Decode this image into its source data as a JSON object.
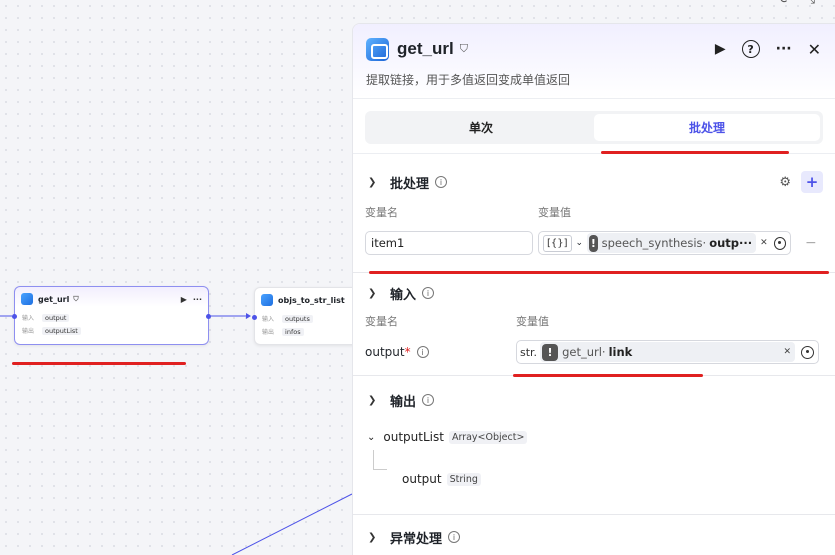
{
  "canvas": {
    "node1": {
      "title": "get_url",
      "input_label": "输入",
      "input_tag": "output",
      "output_label": "输出",
      "output_tag": "outputList"
    },
    "node2": {
      "title": "objs_to_str_list",
      "input_label": "输入",
      "input_tag": "outputs",
      "output_label": "输出",
      "output_tag": "infos"
    }
  },
  "panel": {
    "title": "get_url",
    "description": "提取链接，用于多值返回变成单值返回",
    "tabs": [
      {
        "label": "单次"
      },
      {
        "label": "批处理"
      }
    ],
    "batch": {
      "title": "批处理",
      "col_name": "变量名",
      "col_value": "变量值",
      "item_name": "item1",
      "type_chip": "[{}]",
      "ref_node": "speech_synthesis",
      "ref_var": "outp···",
      "add": "+",
      "remove": "−"
    },
    "input": {
      "title": "输入",
      "col_name": "变量名",
      "col_value": "变量值",
      "var_name": "output",
      "required_mark": "*",
      "type_chip": "str.",
      "ref_node": "get_url",
      "ref_var": "link"
    },
    "output": {
      "title": "输出",
      "items": [
        {
          "name": "outputList",
          "type": "Array<Object>"
        },
        {
          "name": "output",
          "type": "String"
        }
      ]
    },
    "exception": {
      "title": "异常处理"
    }
  }
}
